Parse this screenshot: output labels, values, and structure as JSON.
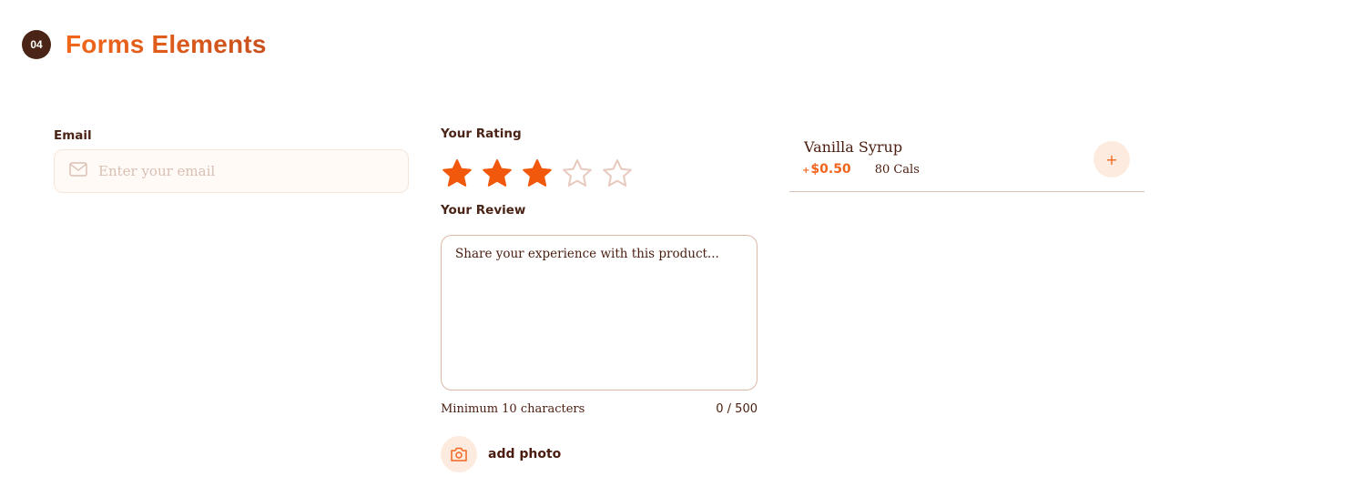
{
  "section": {
    "number": "04",
    "title": "Forms Elements"
  },
  "email": {
    "label": "Email",
    "placeholder": "Enter your email"
  },
  "rating": {
    "label": "Your Rating",
    "value": 3,
    "max": 5
  },
  "review": {
    "label": "Your Review",
    "placeholder": "Share your experience with this product...",
    "hint": "Minimum 10 characters",
    "counter": "0 / 500"
  },
  "photo": {
    "label": "add photo"
  },
  "addon": {
    "name": "Vanilla Syrup",
    "plus_sign": "+",
    "price": "$0.50",
    "calories": "80 Cals",
    "add_symbol": "+"
  },
  "colors": {
    "accent": "#f2580c",
    "dark_brown": "#4a2416",
    "star_empty": "#e8c9bd",
    "soft_peach": "#fdebe0"
  },
  "icons": {
    "email": "mail-icon",
    "photo": "camera-icon",
    "star": "star-icon"
  }
}
